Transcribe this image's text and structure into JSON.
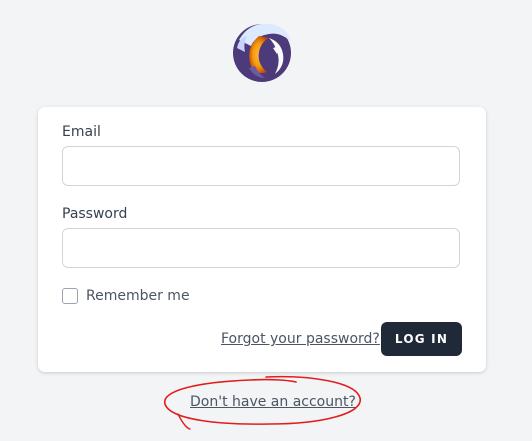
{
  "logo": {
    "icon": "app-logo-icon"
  },
  "form": {
    "email_label": "Email",
    "email_value": "",
    "password_label": "Password",
    "password_value": "",
    "remember_label": "Remember me",
    "forgot_label": "Forgot your password?",
    "login_label": "LOG IN"
  },
  "footer": {
    "register_label": "Don't have an account?"
  },
  "colors": {
    "button_bg": "#1f2937",
    "annotation": "#e11d1d",
    "background": "#f3f4f6"
  }
}
